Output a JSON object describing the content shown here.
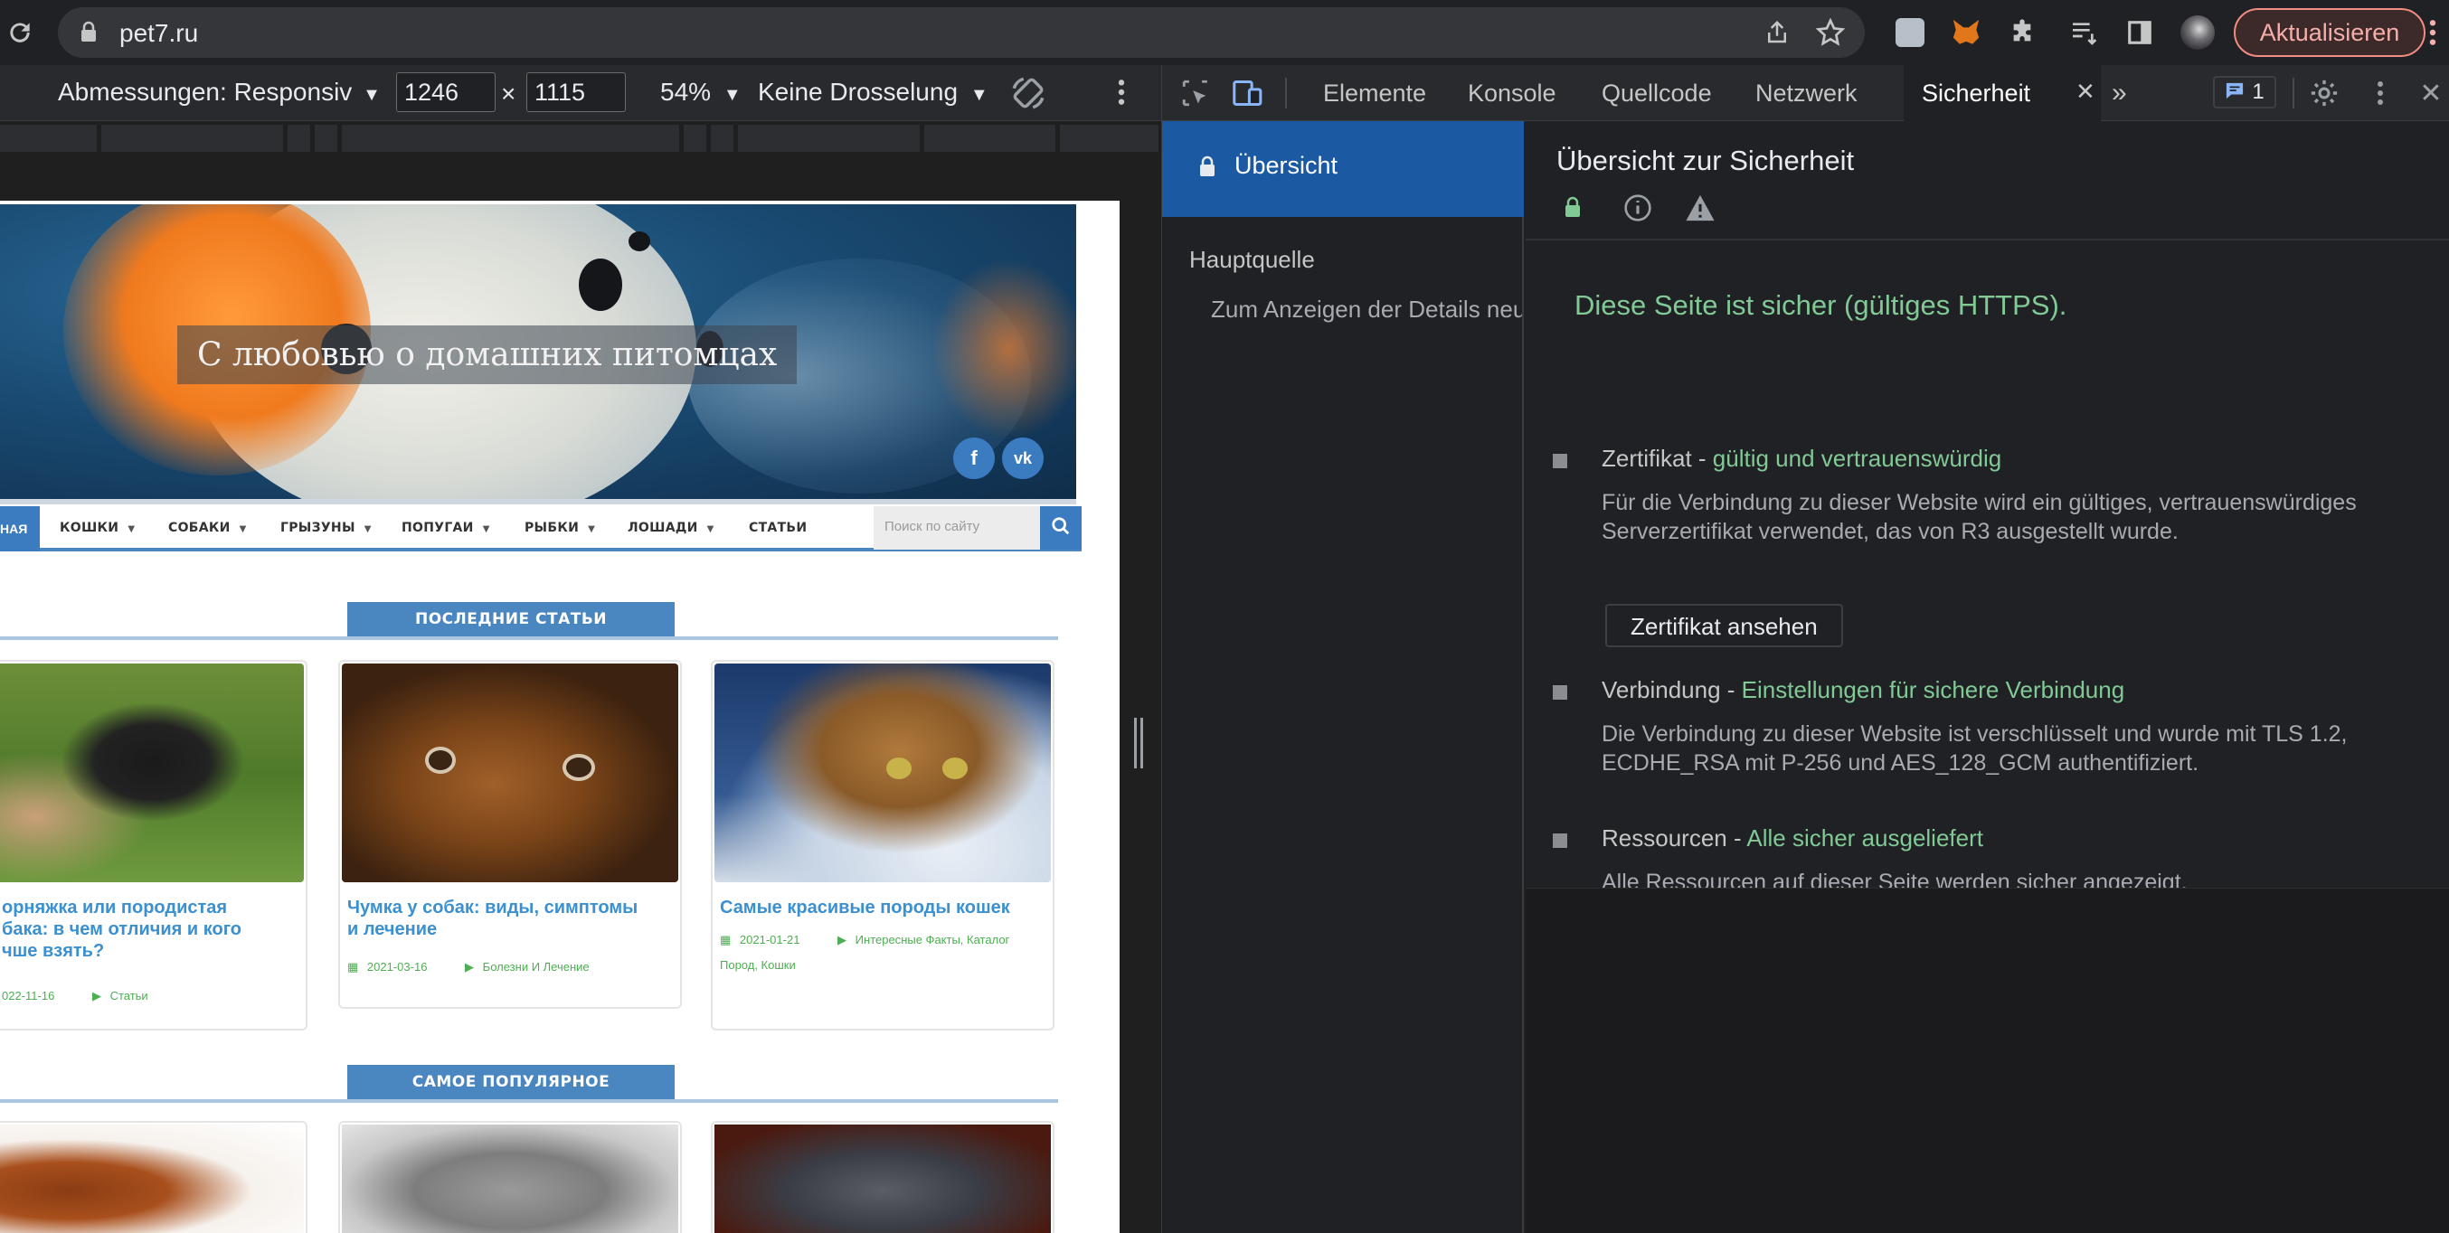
{
  "browser": {
    "url": "pet7.ru",
    "update_label": "Aktualisieren"
  },
  "device_toolbar": {
    "dimensions_label": "Abmessungen: Responsiv",
    "width": "1246",
    "times": "×",
    "height": "1115",
    "zoom": "54%",
    "throttle": "Keine Drosselung"
  },
  "site": {
    "banner_title": "С любовью о домашних питомцах",
    "social": [
      "f",
      "vk"
    ],
    "nav_home": "НАЯ",
    "nav": [
      "КОШКИ",
      "СОБАКИ",
      "ГРЫЗУНЫ",
      "ПОПУГАИ",
      "РЫБКИ",
      "ЛОШАДИ",
      "СТАТЬИ"
    ],
    "search_placeholder": "Поиск по сайту",
    "section_latest": "ПОСЛЕДНИЕ СТАТЬИ",
    "section_popular": "САМОЕ ПОПУЛЯРНОЕ",
    "cards": [
      {
        "title": "орняжка или породистая\nбака: в чем отличия и кого\nчше взять?",
        "date": "022-11-16",
        "tags": "Статьи"
      },
      {
        "title": "Чумка у собак: виды, симптомы\nи лечение",
        "date": "2021-03-16",
        "tags": "Болезни И Лечение"
      },
      {
        "title": "Самые красивые породы кошек",
        "date": "2021-01-21",
        "tags": "Интересные Факты, Каталог",
        "tags2": "Пород, Кошки"
      }
    ]
  },
  "devtools": {
    "tabs": [
      "Elemente",
      "Konsole",
      "Quellcode",
      "Netzwerk",
      "Sicherheit"
    ],
    "issues_count": "1",
    "sidebar": {
      "overview": "Übersicht",
      "main_origin": "Hauptquelle",
      "hint": "Zum Anzeigen der Details neu laden"
    },
    "security": {
      "title": "Übersicht zur Sicherheit",
      "headline": "Diese Seite ist sicher (gültiges HTTPS).",
      "certificate": {
        "label": "Zertifikat - ",
        "status": "gültig und vertrauenswürdig",
        "desc": "Für die Verbindung zu dieser Website wird ein gültiges, vertrauenswürdiges Serverzertifikat verwendet, das von R3 ausgestellt wurde.",
        "button": "Zertifikat ansehen"
      },
      "connection": {
        "label": "Verbindung - ",
        "status": "Einstellungen für sichere Verbindung",
        "desc": "Die Verbindung zu dieser Website ist verschlüsselt und wurde mit TLS 1.2, ECDHE_RSA mit P-256 und AES_128_GCM authentifiziert."
      },
      "resources": {
        "label": "Ressourcen - ",
        "status": "Alle sicher ausgeliefert",
        "desc": "Alle Ressourcen auf dieser Seite werden sicher angezeigt."
      }
    }
  },
  "colors": {
    "secure_green": "#81c995",
    "site_blue": "#3b7bbf",
    "devtools_selected": "#1b5aa3",
    "update_red": "#f28b82"
  }
}
